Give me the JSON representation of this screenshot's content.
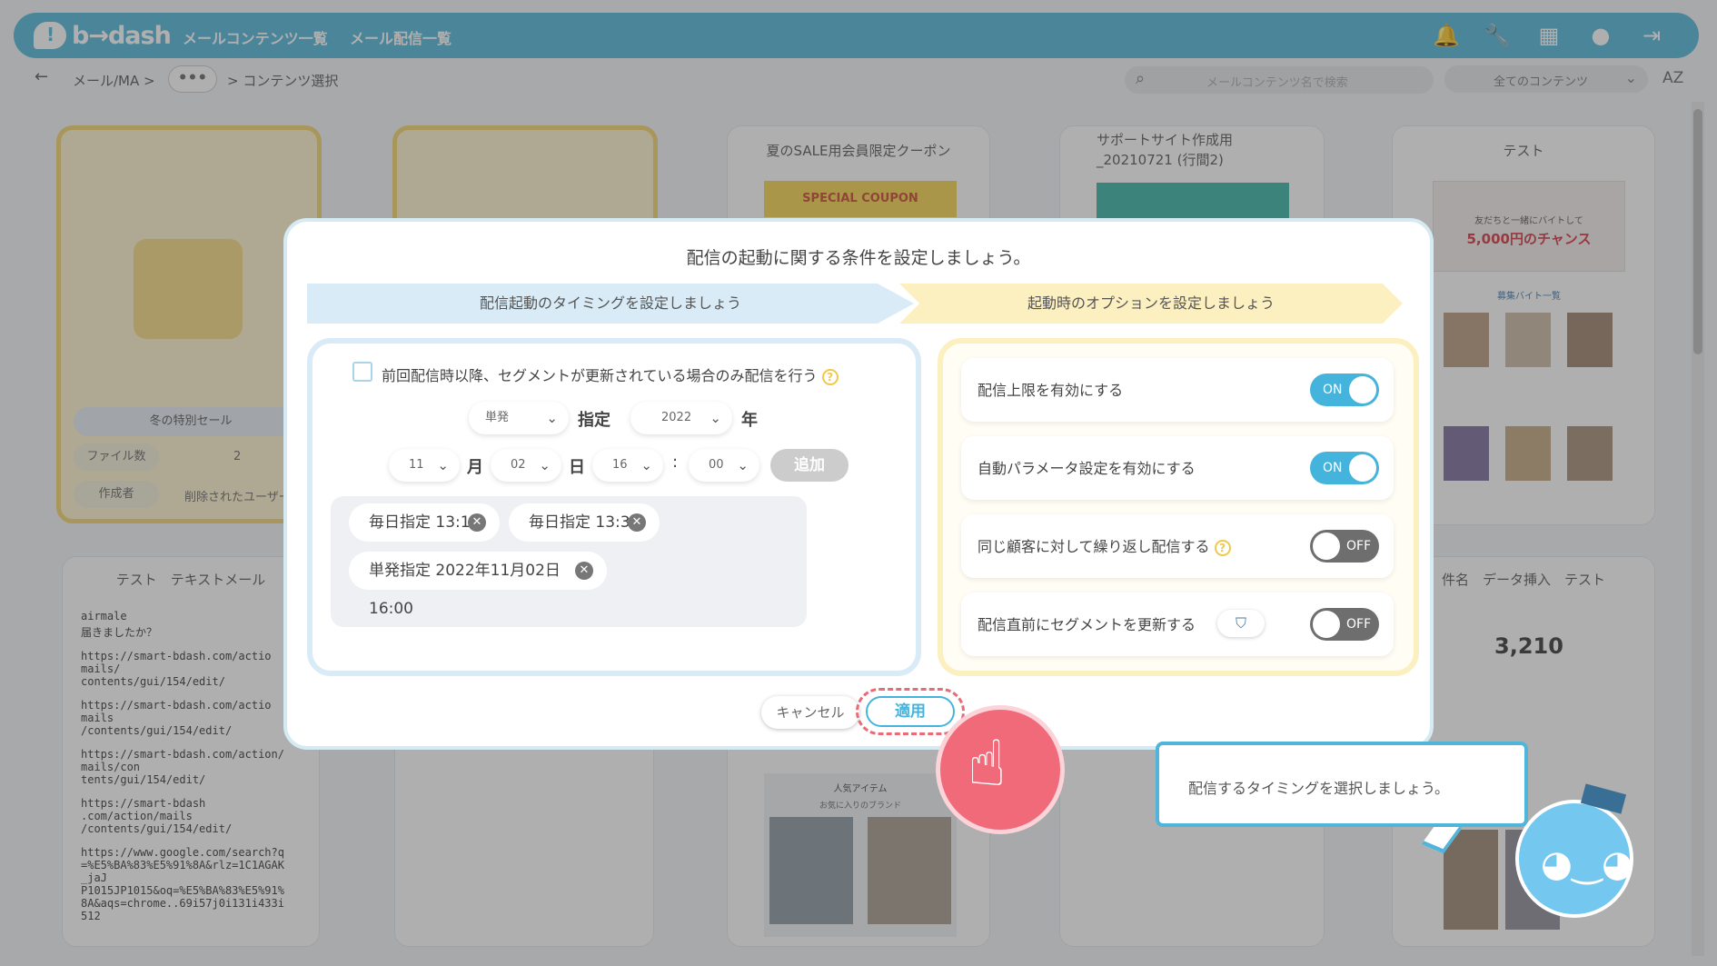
{
  "header": {
    "brand": "b→dash",
    "nav": [
      "メールコンテンツ一覧",
      "メール配信一覧"
    ],
    "icons": [
      "bell-icon",
      "wrench-icon",
      "grid-icon",
      "chat-icon",
      "logout-icon"
    ]
  },
  "breadcrumb": {
    "parent": "メール/MA >",
    "more": "•••",
    "current": "> コンテンツ選択"
  },
  "search": {
    "placeholder": "メールコンテンツ名で検索"
  },
  "filter": {
    "selected": "全てのコンテンツ",
    "sort": "AZ"
  },
  "cards": {
    "folder1": {
      "name": "冬の特別セール",
      "files_label": "ファイル数",
      "files_value": "2",
      "author_label": "作成者",
      "author_value": "削除されたユーザー"
    },
    "c3": {
      "title": "夏のSALE用会員限定クーポン",
      "banner": "SPECIAL COUPON"
    },
    "c4": {
      "title": "サポートサイト作成用_20210721 (行間2)"
    },
    "c5": {
      "title": "テスト",
      "promo_text": "友だちと一緒にバイトして",
      "promo_big": "5,000円のチャンス",
      "promo_sub": "募集バイト一覧"
    },
    "r2c1": {
      "title": "テスト　テキストメール"
    },
    "r2c5": {
      "title": "件名　データ挿入　テスト",
      "points": "3,210"
    },
    "ranking_label": "人気アイテム",
    "ranking_sub": "お気に入りのブランド",
    "text_mail_lines": [
      "airmale",
      "届きましたか？",
      "https://smart-bdash.com/actio",
      "mails/",
      "contents/gui/154/edit/",
      "https://smart-bdash.com/actio",
      "mails",
      "/contents/gui/154/edit/",
      "https://smart-bdash.com/action/",
      "mails/con",
      "tents/gui/154/edit/",
      "https://smart-bdash",
      ".com/action/mails",
      "/contents/gui/154/edit/",
      "https://www.google.com/search?q",
      "=%E5%BA%83%E5%91%8A&rlz=1C1AGAK",
      "_jaJ",
      "P1015JP1015&oq=%E5%BA%83%E5%91%",
      "8A&aqs=chrome..69i57j0i131i433i",
      "512"
    ]
  },
  "modal": {
    "title": "配信の起動に関する条件を設定しましょう。",
    "step1": "配信起動のタイミングを設定しましょう",
    "step2": "起動時のオプションを設定しましょう",
    "checkbox_label": "前回配信時以降、セグメントが更新されている場合のみ配信を行う",
    "type_value": "単発",
    "type_label": "指定",
    "year_value": "2022",
    "year_label": "年",
    "month_value": "11",
    "month_label": "月",
    "day_value": "02",
    "day_label": "日",
    "hour_value": "16",
    "colon": ":",
    "minute_value": "00",
    "add_label": "追加",
    "tags": [
      "毎日指定 13:15",
      "毎日指定 13:30",
      "単発指定 2022年11月02日 16:00"
    ],
    "options": [
      {
        "label": "配信上限を有効にする",
        "state": "ON"
      },
      {
        "label": "自動パラメータ設定を有効にする",
        "state": "ON"
      },
      {
        "label": "同じ顧客に対して繰り返し配信する",
        "state": "OFF"
      },
      {
        "label": "配信直前にセグメントを更新する",
        "state": "OFF"
      }
    ],
    "cancel": "キャンセル",
    "apply": "適用"
  },
  "tooltip": {
    "text": "配信するタイミングを選択しましょう。"
  },
  "colors": {
    "accent": "#4fb5da",
    "highlight": "#f06a7a",
    "folder": "#f4d36b",
    "step2": "#fcefc0"
  }
}
